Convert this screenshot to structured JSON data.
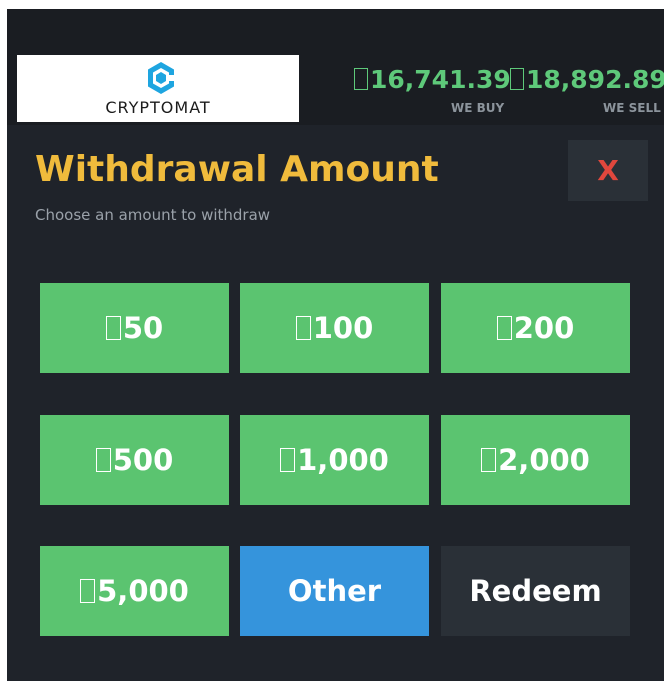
{
  "header": {
    "logo_text": "CRYPTOMAT",
    "buy_price": "16,741.39",
    "buy_label": "WE BUY",
    "sell_price": "18,892.89",
    "sell_label": "WE SELL",
    "currency_glyph": "missing-glyph-box",
    "price_color": "#5ec97a"
  },
  "panel": {
    "title": "Withdrawal Amount",
    "subtitle": "Choose an amount to withdraw",
    "close_label": "X",
    "title_color": "#f0bb3c"
  },
  "amounts": [
    {
      "label": "50"
    },
    {
      "label": "100"
    },
    {
      "label": "200"
    },
    {
      "label": "500"
    },
    {
      "label": "1,000"
    },
    {
      "label": "2,000"
    },
    {
      "label": "5,000"
    }
  ],
  "actions": {
    "other_label": "Other",
    "redeem_label": "Redeem"
  },
  "colors": {
    "amount_button": "#5bc470",
    "other_button": "#3594dc",
    "redeem_button": "#2a3037",
    "close_x": "#e0473d",
    "background": "#1f232a"
  }
}
